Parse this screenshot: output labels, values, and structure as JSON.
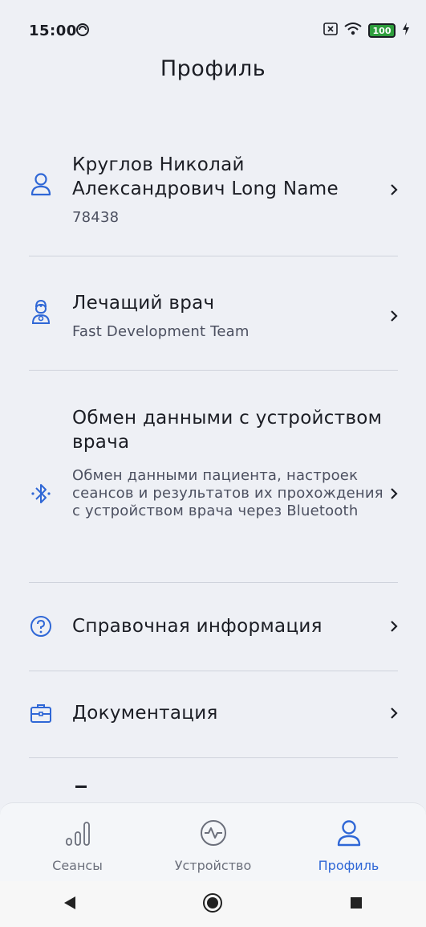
{
  "status_bar": {
    "time": "15:00",
    "battery": "100"
  },
  "page": {
    "title": "Профиль"
  },
  "menu": {
    "items": [
      {
        "title": "Круглов Николай Александрович Long Name",
        "subtitle": "78438",
        "icon": "user-icon"
      },
      {
        "title": "Лечащий врач",
        "subtitle": "Fast Development Team",
        "icon": "doctor-icon"
      },
      {
        "title": "Обмен данными с устройством врача",
        "subtitle": "Обмен данными пациента, настроек сеансов и результатов их прохождения с устройством врача через Bluetooth",
        "icon": "bluetooth-icon"
      },
      {
        "title": "Справочная информация",
        "icon": "help-icon"
      },
      {
        "title": "Документация",
        "icon": "briefcase-icon"
      }
    ]
  },
  "bottom_nav": {
    "tabs": [
      {
        "label": "Сеансы",
        "icon": "sessions-icon"
      },
      {
        "label": "Устройство",
        "icon": "device-icon"
      },
      {
        "label": "Профиль",
        "icon": "profile-icon",
        "active": true
      }
    ]
  },
  "colors": {
    "accent": "#2f67d6",
    "background": "#eef0f5",
    "text": "#1b1d24"
  }
}
